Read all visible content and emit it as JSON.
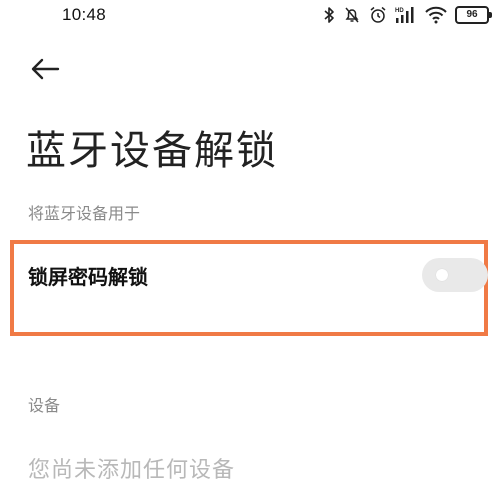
{
  "status_bar": {
    "time": "10:48",
    "battery": "96",
    "icons": [
      "bluetooth-icon",
      "mute-icon",
      "alarm-icon",
      "hd-signal-icon",
      "wifi-icon",
      "battery-icon"
    ]
  },
  "header": {
    "back_icon": "arrow-left-icon",
    "title": "蓝牙设备解锁"
  },
  "sections": {
    "use_for_label": "将蓝牙设备用于",
    "lock_screen": {
      "label": "锁屏密码解锁",
      "toggle_on": false
    },
    "devices_label": "设备",
    "empty_devices_text": "您尚未添加任何设备"
  },
  "colors": {
    "highlight": "#f07a45",
    "toggle_off": "#e9e9e9",
    "secondary_text": "#8a8a8a",
    "placeholder_text": "#b8b8b8"
  }
}
